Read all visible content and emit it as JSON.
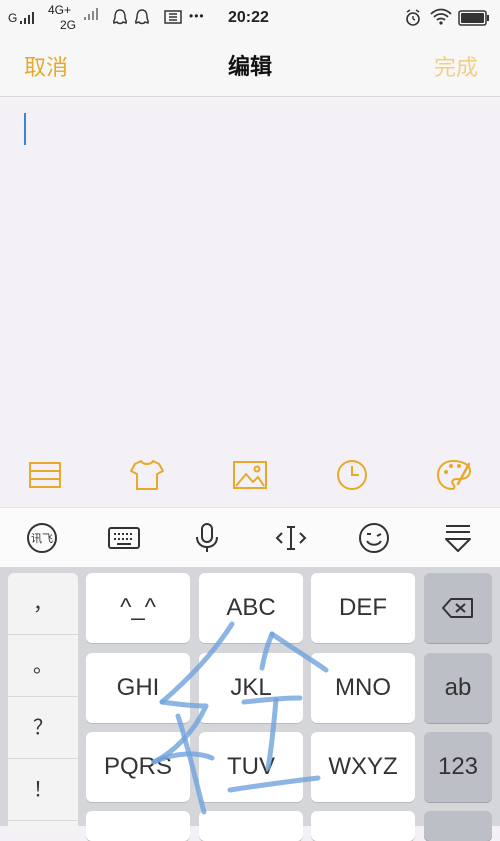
{
  "status_bar": {
    "carrier_g": "G",
    "network_top": "4G+",
    "network_bottom": "2G",
    "more_dots": "•••",
    "time": "20:22"
  },
  "nav": {
    "cancel_label": "取消",
    "title": "编辑",
    "done_label": "完成"
  },
  "editor": {
    "text": ""
  },
  "note_toolbar": [
    "checklist-icon",
    "shirt-icon",
    "image-icon",
    "clock-icon",
    "palette-icon"
  ],
  "ime_toolbar": [
    "ime-logo-icon",
    "keyboard-icon",
    "microphone-icon",
    "cursor-move-icon",
    "emoji-icon",
    "collapse-keyboard-icon"
  ],
  "keyboard": {
    "punctuation": [
      "，",
      "。",
      "？",
      "！"
    ],
    "row1": [
      "^_^",
      "ABC",
      "DEF"
    ],
    "row2": [
      "GHI",
      "JKL",
      "MNO"
    ],
    "row3": [
      "PQRS",
      "TUV",
      "WXYZ"
    ],
    "fn": {
      "ab": "ab",
      "num": "123"
    }
  },
  "colors": {
    "accent": "#e6a92c",
    "done_disabled": "#f1cf86",
    "cursor": "#3d86cc",
    "handwriting_stroke": "#6fa3dd"
  }
}
